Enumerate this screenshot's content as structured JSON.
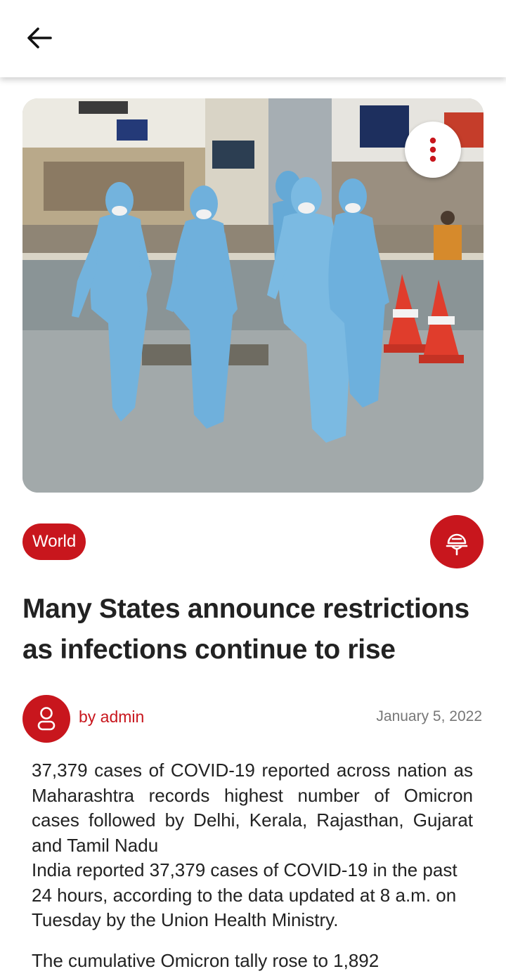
{
  "header": {
    "back_icon": "arrow-left-icon"
  },
  "hero": {
    "image_description_icon": "photo",
    "menu_icon": "vertical-dots-icon"
  },
  "article": {
    "category": "World",
    "listen_icon": "podcast-mic-icon",
    "title": "Many States announce restrictions as infections continue to rise",
    "author": "by admin",
    "author_icon": "user-icon",
    "date": "January 5, 2022",
    "paragraph_1": "37,379 cases of COVID-19 reported across nation as Maharashtra records highest number of Omicron cases followed by Delhi, Kerala, Rajasthan, Gujarat and Tamil Nadu",
    "paragraph_2": "India reported 37,379 cases of COVID-19 in the past 24 hours, according to the data updated at 8 a.m. on Tuesday by the Union Health Ministry.",
    "paragraph_3": "The cumulative Omicron tally rose to 1,892"
  },
  "colors": {
    "accent": "#c8161d",
    "text": "#222222",
    "muted": "#777777"
  }
}
